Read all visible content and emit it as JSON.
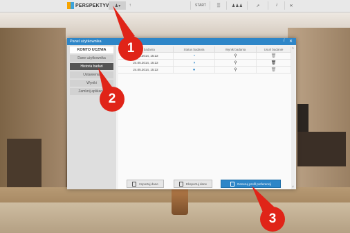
{
  "toolbar": {
    "logo": "PERSPEKTYWY",
    "user_label": "▾",
    "start": "START",
    "info": "i",
    "close": "✕"
  },
  "dialog": {
    "title": "Panel użytkownika",
    "close": "✕",
    "help": "i",
    "sidebar": {
      "header": "KONTO UCZNIA",
      "items": [
        "Dane użytkownika",
        "Historia badań",
        "Ustawienia",
        "Wyniki",
        "Zamknij aplikację"
      ]
    },
    "table": {
      "headers": [
        "Data badania",
        "Status badania",
        "Wynik badania",
        "Usuń badanie"
      ],
      "rows": [
        {
          "date": "24.05.2014, 15:22"
        },
        {
          "date": "24.05.2014, 15:22"
        },
        {
          "date": "24.05.2014, 15:22"
        }
      ]
    },
    "buttons": {
      "import": "Importuj dane",
      "export": "Eksportuj dane",
      "profile": "Generuj profil preferencji"
    }
  },
  "callouts": [
    "1",
    "2",
    "3"
  ]
}
